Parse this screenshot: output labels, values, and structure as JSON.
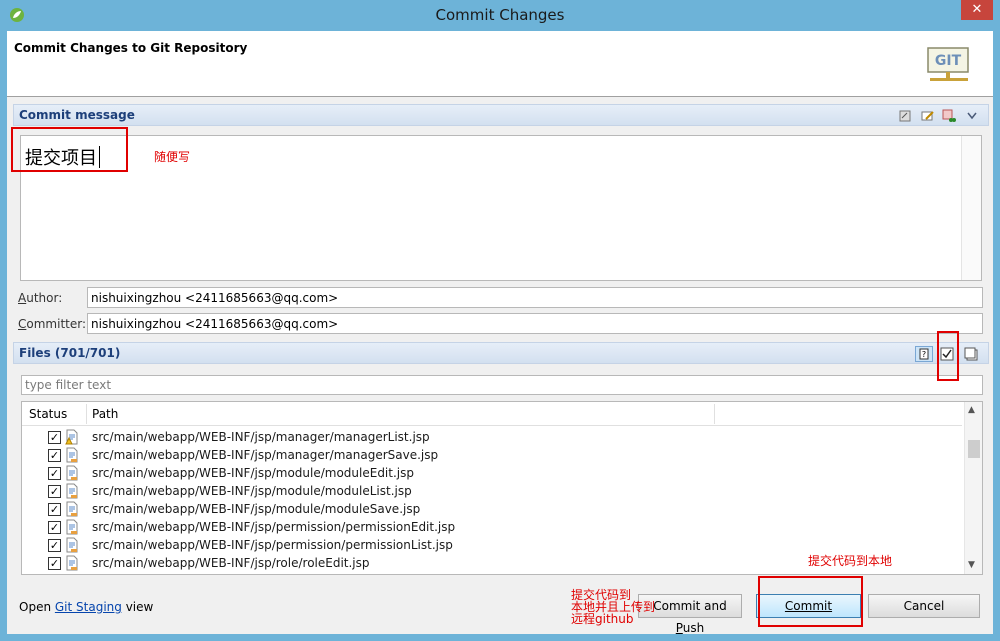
{
  "window": {
    "title": "Commit Changes",
    "close_glyph": "✕"
  },
  "header": {
    "title": "Commit Changes to Git Repository",
    "logo_text": "GIT"
  },
  "commit_message": {
    "section_title": "Commit message",
    "value": "提交项目"
  },
  "author": {
    "label_prefix": "A",
    "label_rest": "uthor:",
    "value": "nishuixingzhou <2411685663@qq.com>"
  },
  "committer": {
    "label_prefix": "C",
    "label_rest": "ommitter:",
    "value": "nishuixingzhou <2411685663@qq.com>"
  },
  "files": {
    "section_title": "Files (701/701)",
    "filter_placeholder": "type filter text",
    "columns": {
      "status": "Status",
      "path": "Path"
    },
    "rows": [
      {
        "path": "src/main/webapp/WEB-INF/jsp/manager/managerList.jsp",
        "checked": "✓"
      },
      {
        "path": "src/main/webapp/WEB-INF/jsp/manager/managerSave.jsp",
        "checked": "✓"
      },
      {
        "path": "src/main/webapp/WEB-INF/jsp/module/moduleEdit.jsp",
        "checked": "✓"
      },
      {
        "path": "src/main/webapp/WEB-INF/jsp/module/moduleList.jsp",
        "checked": "✓"
      },
      {
        "path": "src/main/webapp/WEB-INF/jsp/module/moduleSave.jsp",
        "checked": "✓"
      },
      {
        "path": "src/main/webapp/WEB-INF/jsp/permission/permissionEdit.jsp",
        "checked": "✓"
      },
      {
        "path": "src/main/webapp/WEB-INF/jsp/permission/permissionList.jsp",
        "checked": "✓"
      },
      {
        "path": "src/main/webapp/WEB-INF/jsp/role/roleEdit.jsp",
        "checked": "✓"
      }
    ]
  },
  "footer": {
    "prefix": "Open ",
    "link": "Git Staging",
    "suffix": " view",
    "commit_and_push_a": "Co",
    "commit_and_push_b": "mmit and ",
    "commit_and_push_c": "P",
    "commit_and_push_d": "ush",
    "commit_label": "Commit",
    "cancel_label": "Cancel"
  },
  "annotations": {
    "message_note": "随便写",
    "commit_note": "提交代码到本地",
    "push_note_line1": "提交代码到",
    "push_note_line2": "本地并且上传到",
    "push_note_line3": "远程github"
  },
  "colors": {
    "annotation": "#e00000",
    "section_title": "#1d3f7a",
    "window_frame": "#6db3d8"
  }
}
